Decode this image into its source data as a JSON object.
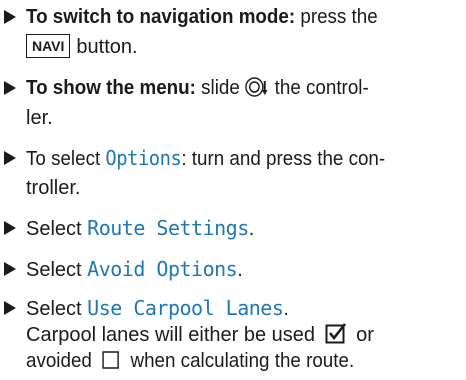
{
  "steps": [
    {
      "bold": "To switch to navigation mode:",
      "text": " press the",
      "line2_key": "NAVI",
      "line2_text": "button."
    },
    {
      "bold": "To show the menu:",
      "text_before": " slide ",
      "text_after": " the control-",
      "line2_text": "ler."
    },
    {
      "text_before": "To select ",
      "mono": "Options",
      "text_after": ": turn and press the con-",
      "line2_text": "troller."
    },
    {
      "text_before": "Select ",
      "mono": "Route Settings",
      "text_after": "."
    },
    {
      "text_before": "Select ",
      "mono": "Avoid Options",
      "text_after": "."
    },
    {
      "text_before": "Select ",
      "mono": "Use Carpool Lanes",
      "text_after": ".",
      "line2_before": "Carpool lanes will either be used ",
      "line2_after": " or",
      "line3_before": "avoided ",
      "line3_after": " when calculating the route."
    }
  ],
  "icons": {
    "controller": "controller-slide-down-icon",
    "checked": "checkbox-checked-icon",
    "unchecked": "checkbox-unchecked-icon"
  },
  "colors": {
    "text": "#1b1b1b",
    "menu_item": "#1e78b4"
  }
}
